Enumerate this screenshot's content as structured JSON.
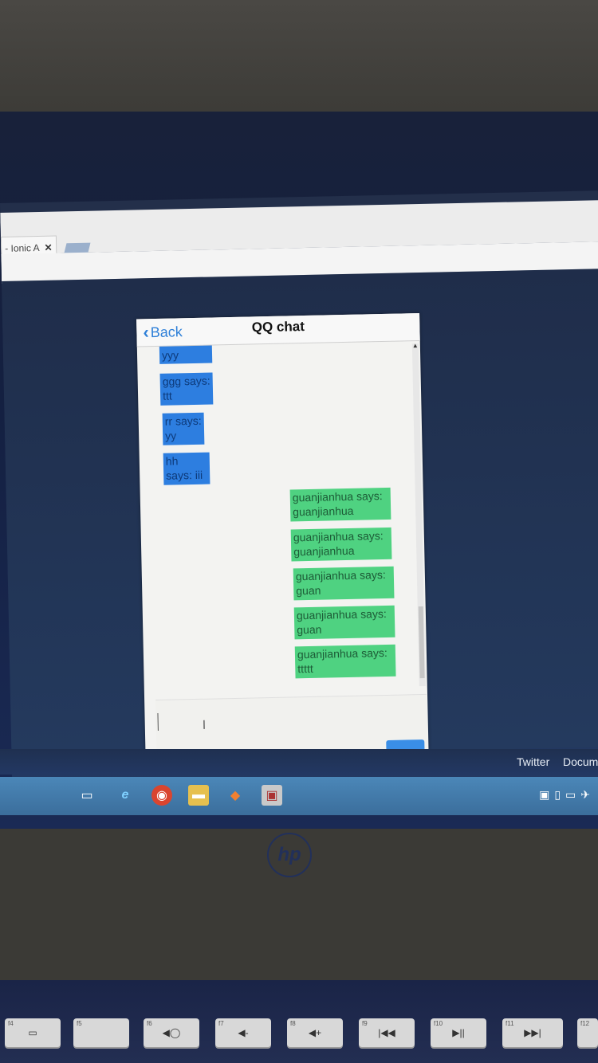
{
  "browser": {
    "tab_label": "- Ionic A",
    "tab_close": "✕"
  },
  "app": {
    "back_label": "Back",
    "title": "QQ chat"
  },
  "messages": [
    {
      "side": "left",
      "text": "yyy"
    },
    {
      "side": "left",
      "text": "ggg says: ttt"
    },
    {
      "side": "left",
      "text": "rr says: yy"
    },
    {
      "side": "left",
      "text": "hh says: iii"
    },
    {
      "side": "right",
      "text": "guanjianhua says: guanjianhua"
    },
    {
      "side": "right",
      "text": "guanjianhua says: guanjianhua"
    },
    {
      "side": "right",
      "text": "guanjianhua says: guan"
    },
    {
      "side": "right",
      "text": "guanjianhua says: guan"
    },
    {
      "side": "right",
      "text": "guanjianhua says: ttttt"
    }
  ],
  "bookmarks": {
    "twitter": "Twitter",
    "documents": "Docum"
  },
  "taskbar_icons": [
    "task-view-icon",
    "edge-icon",
    "chrome-icon",
    "file-explorer-icon",
    "git-icon",
    "app-icon"
  ],
  "keyboard": {
    "keys": [
      {
        "fn": "f4",
        "label": "▭"
      },
      {
        "fn": "f5",
        "label": ""
      },
      {
        "fn": "f6",
        "label": "◀◯"
      },
      {
        "fn": "f7",
        "label": "◀-"
      },
      {
        "fn": "f8",
        "label": "◀+"
      },
      {
        "fn": "f9",
        "label": "|◀◀"
      },
      {
        "fn": "f10",
        "label": "▶||"
      },
      {
        "fn": "f11",
        "label": "▶▶|"
      },
      {
        "fn": "f12",
        "label": ""
      }
    ]
  },
  "brand": "hp"
}
